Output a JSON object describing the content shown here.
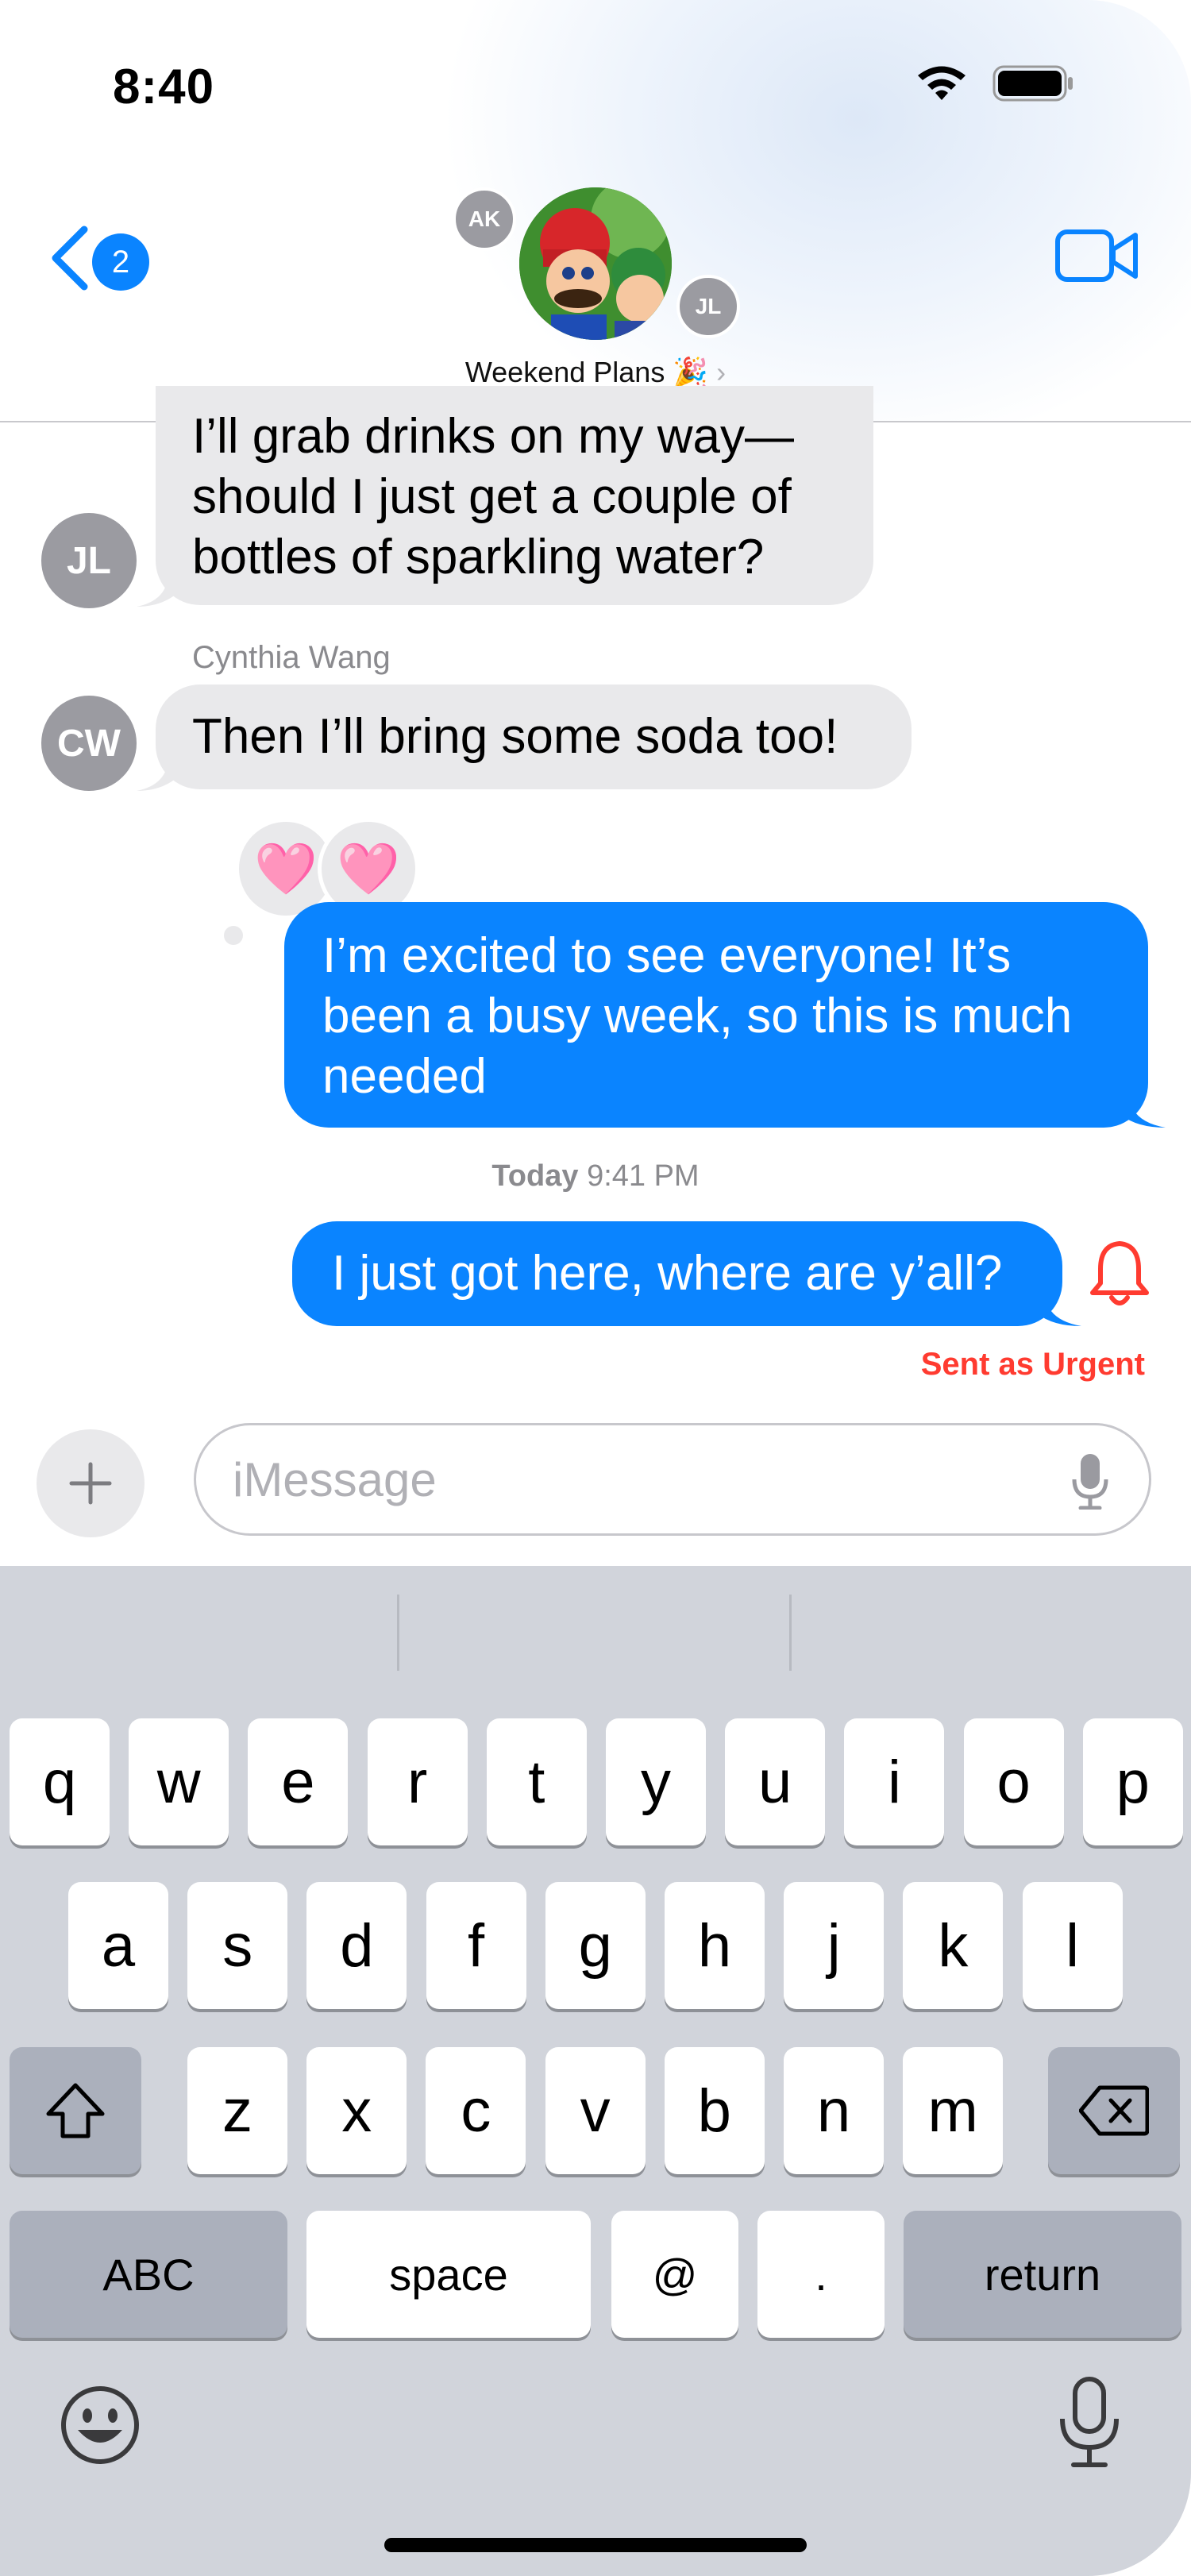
{
  "status": {
    "time": "8:40"
  },
  "nav": {
    "back_badge": "2",
    "group_title": "Weekend Plans 🎉",
    "members": [
      "AK",
      "JL"
    ]
  },
  "messages": [
    {
      "from": "JL",
      "type": "received",
      "text_lines": [
        "I’ll grab drinks on my way—",
        "should I just get a couple of",
        "bottles of sparkling water?"
      ]
    },
    {
      "from": "CW",
      "sender_name": "Cynthia Wang",
      "type": "received",
      "text": "Then I’ll bring some soda too!"
    },
    {
      "type": "sent",
      "reactions": [
        "🩷",
        "🩷"
      ],
      "text_lines": [
        "I’m excited to see everyone! It’s",
        "been a busy week, so this is much",
        "needed"
      ]
    },
    {
      "type": "sent",
      "text": "I just got here, where are y’all?",
      "status": "Sent as Urgent"
    }
  ],
  "timestamp": {
    "day": "Today",
    "time": "9:41 PM"
  },
  "composer": {
    "placeholder": "iMessage"
  },
  "keyboard": {
    "row1": [
      "q",
      "w",
      "e",
      "r",
      "t",
      "y",
      "u",
      "i",
      "o",
      "p"
    ],
    "row2": [
      "a",
      "s",
      "d",
      "f",
      "g",
      "h",
      "j",
      "k",
      "l"
    ],
    "row3": [
      "z",
      "x",
      "c",
      "v",
      "b",
      "n",
      "m"
    ],
    "abc": "ABC",
    "space": "space",
    "at": "@",
    "dot": ".",
    "return": "return"
  },
  "colors": {
    "accent": "#0a84ff",
    "urgent": "#ff3b30",
    "received_bubble": "#e9e9eb"
  }
}
